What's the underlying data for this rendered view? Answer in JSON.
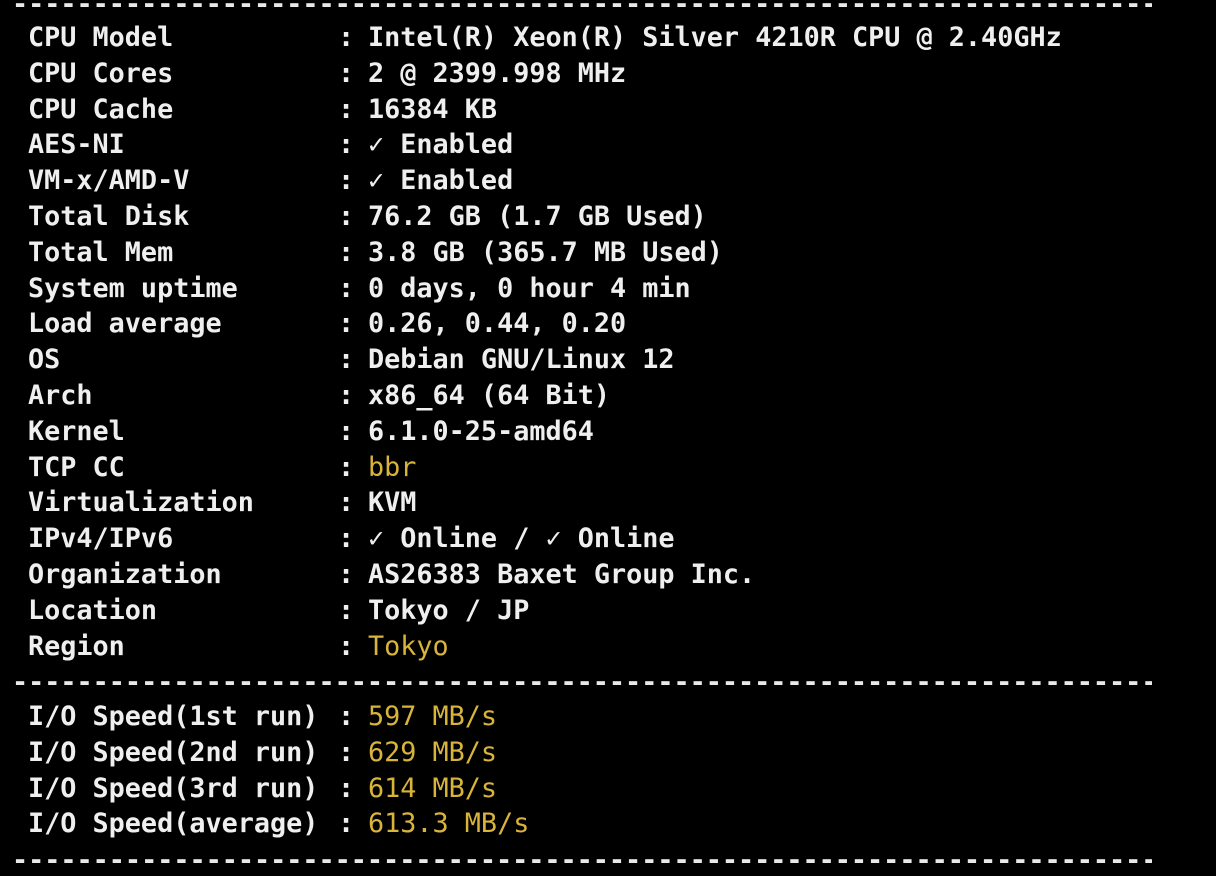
{
  "separator": "-----------------------------------------------------------------------------------",
  "info": [
    {
      "label": "CPU Model",
      "value": "Intel(R) Xeon(R) Silver 4210R CPU @ 2.40GHz",
      "highlight": false
    },
    {
      "label": "CPU Cores",
      "value": "2 @ 2399.998 MHz",
      "highlight": false
    },
    {
      "label": "CPU Cache",
      "value": "16384 KB",
      "highlight": false
    },
    {
      "label": "AES-NI",
      "value": "✓ Enabled",
      "highlight": false
    },
    {
      "label": "VM-x/AMD-V",
      "value": "✓ Enabled",
      "highlight": false
    },
    {
      "label": "Total Disk",
      "value": "76.2 GB (1.7 GB Used)",
      "highlight": false
    },
    {
      "label": "Total Mem",
      "value": "3.8 GB (365.7 MB Used)",
      "highlight": false
    },
    {
      "label": "System uptime",
      "value": "0 days, 0 hour 4 min",
      "highlight": false
    },
    {
      "label": "Load average",
      "value": "0.26, 0.44, 0.20",
      "highlight": false
    },
    {
      "label": "OS",
      "value": "Debian GNU/Linux 12",
      "highlight": false
    },
    {
      "label": "Arch",
      "value": "x86_64 (64 Bit)",
      "highlight": false
    },
    {
      "label": "Kernel",
      "value": "6.1.0-25-amd64",
      "highlight": false
    },
    {
      "label": "TCP CC",
      "value": "bbr",
      "highlight": true
    },
    {
      "label": "Virtualization",
      "value": "KVM",
      "highlight": false
    },
    {
      "label": "IPv4/IPv6",
      "value": "✓ Online / ✓ Online",
      "highlight": false
    },
    {
      "label": "Organization",
      "value": "AS26383 Baxet Group Inc.",
      "highlight": false
    },
    {
      "label": "Location",
      "value": "Tokyo / JP",
      "highlight": false
    },
    {
      "label": "Region",
      "value": "Tokyo",
      "highlight": true
    }
  ],
  "io": [
    {
      "label": "I/O Speed(1st run)",
      "value": "597 MB/s",
      "highlight": true
    },
    {
      "label": "I/O Speed(2nd run)",
      "value": "629 MB/s",
      "highlight": true
    },
    {
      "label": "I/O Speed(3rd run)",
      "value": "614 MB/s",
      "highlight": true
    },
    {
      "label": "I/O Speed(average)",
      "value": "613.3 MB/s",
      "highlight": true
    }
  ],
  "colon": ":",
  "colors": {
    "background": "#000000",
    "text": "#efefef",
    "highlight": "#d9b43a"
  }
}
